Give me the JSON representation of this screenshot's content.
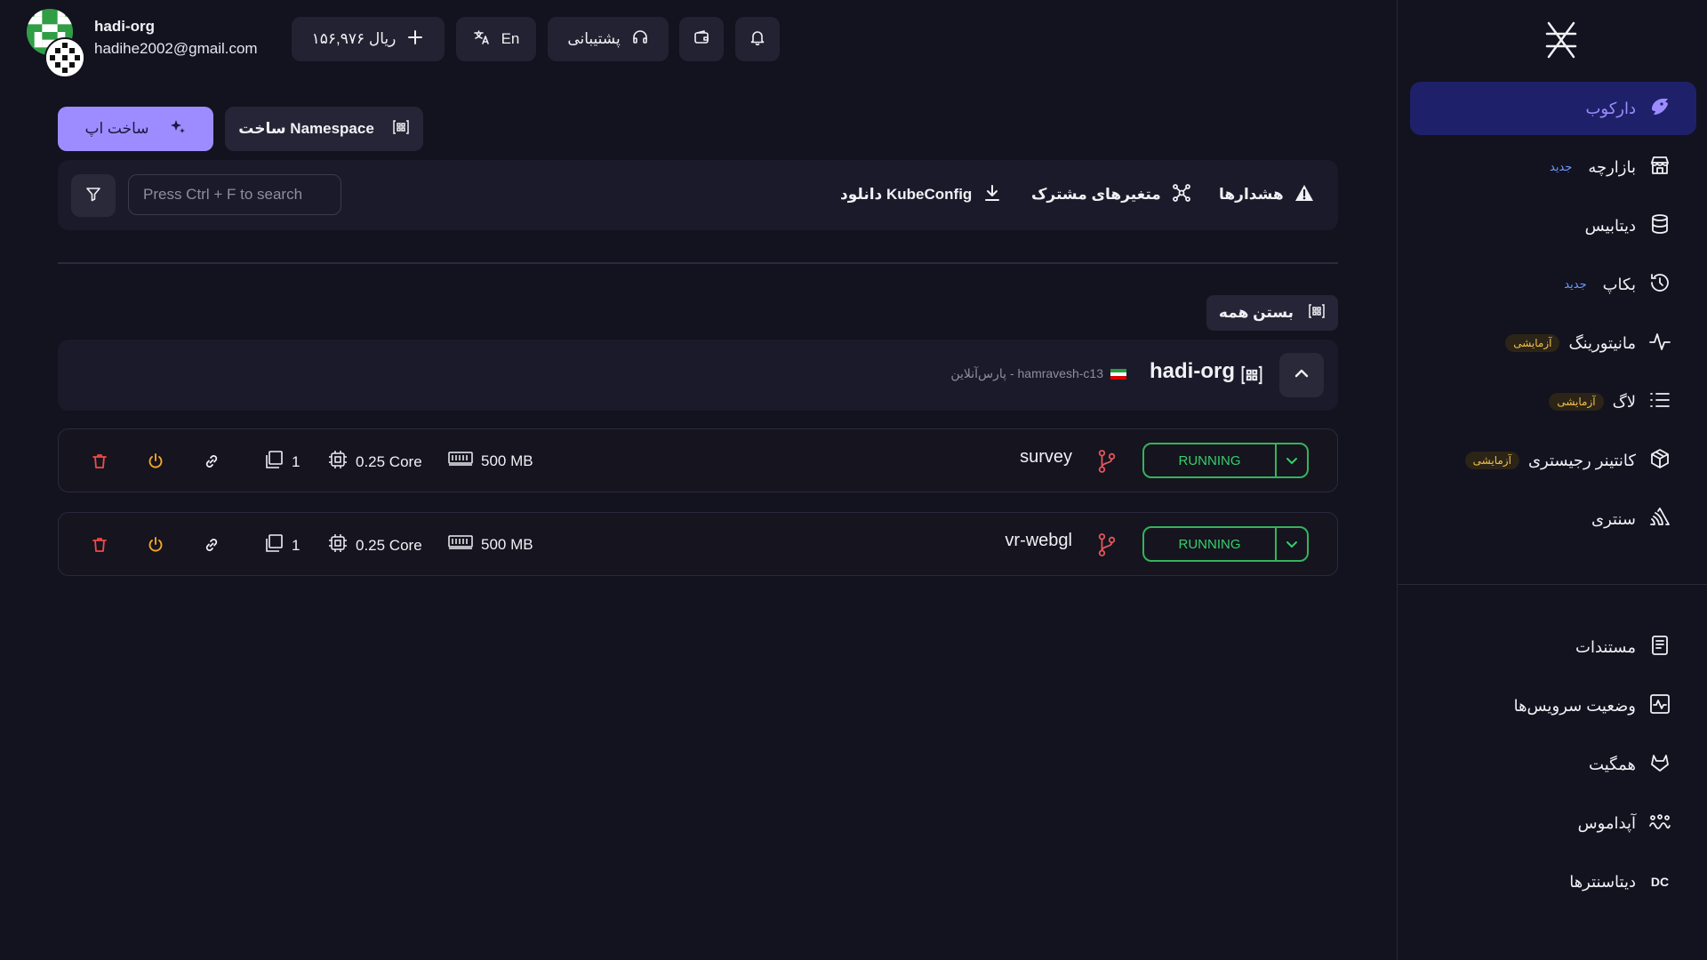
{
  "user": {
    "name": "hadi-org",
    "email": "hadihe2002@gmail.com"
  },
  "topbar": {
    "balance": "ریال ۱۵۶,۹۷۶",
    "language": "En",
    "support": "پشتیبانی"
  },
  "actions": {
    "create_app": "ساخت اپ",
    "create_namespace": "ساخت Namespace"
  },
  "toolbar": {
    "search_placeholder": "Press Ctrl + F to search",
    "kubeconfig": "دانلود KubeConfig",
    "shared_vars": "متغیرهای مشترک",
    "alerts": "هشدارها"
  },
  "collapse_all": "بستن همه",
  "namespace": {
    "name": "hadi-org",
    "region": "پارس‌آنلاین - hamravesh-c13"
  },
  "apps": [
    {
      "name": "survey",
      "status": "RUNNING",
      "memory": "500 MB",
      "cpu": "0.25 Core",
      "replicas": "1"
    },
    {
      "name": "vr-webgl",
      "status": "RUNNING",
      "memory": "500 MB",
      "cpu": "0.25 Core",
      "replicas": "1"
    }
  ],
  "sidebar": {
    "items": [
      {
        "label": "دارکوب",
        "icon": "darkube-icon",
        "active": true
      },
      {
        "label": "بازارچه",
        "badge": "جدید",
        "icon": "store-icon"
      },
      {
        "label": "دیتابیس",
        "icon": "database-icon"
      },
      {
        "label": "بکاپ",
        "badge": "جدید",
        "icon": "history-icon"
      },
      {
        "label": "مانیتورینگ",
        "badge": "آزمایشی",
        "icon": "activity-icon"
      },
      {
        "label": "لاگ",
        "badge": "آزمایشی",
        "icon": "list-icon"
      },
      {
        "label": "کانتینر رجیستری",
        "badge": "آزمایشی",
        "icon": "box-icon"
      },
      {
        "label": "سنتری",
        "icon": "sentry-icon"
      },
      {
        "label": "مستندات",
        "icon": "document-icon"
      },
      {
        "label": "وضعیت سرویس‌ها",
        "icon": "status-icon"
      },
      {
        "label": "همگیت",
        "icon": "gitlab-icon"
      },
      {
        "label": "آپداموس",
        "icon": "updamus-icon"
      },
      {
        "label": "دیتاسنترها",
        "icon": "dc-icon",
        "icon_text": "DC"
      }
    ]
  },
  "colors": {
    "accent": "#9d8cff",
    "running": "#36d06a",
    "delete": "#f04a4a",
    "power": "#f5a623",
    "branch": "#e0565b"
  }
}
